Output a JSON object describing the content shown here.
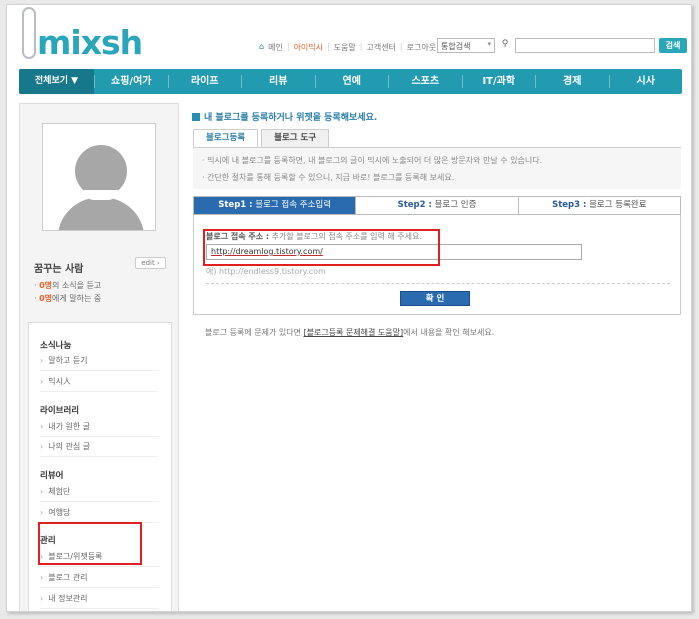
{
  "brand": {
    "logo": "mixsh",
    "accent": "#2aa6ba",
    "nav_bg": "#229aaf",
    "step_active": "#2a6bb0",
    "highlight": "#e02020"
  },
  "top_links": {
    "home_icon": "home-icon",
    "items": [
      "메인",
      "아이믹시",
      "도움말",
      "고객센터",
      "로그아웃"
    ]
  },
  "search": {
    "scope": "통합검색",
    "search_icon": "magnifier-icon",
    "button": "검색"
  },
  "gnb": {
    "items": [
      "전체보기 ▼",
      "쇼핑/여가",
      "라이프",
      "리뷰",
      "연예",
      "스포츠",
      "IT/과학",
      "경제",
      "시사"
    ]
  },
  "profile": {
    "name": "꿈꾸는 사람",
    "edit_label": "edit ›",
    "stat1_count": "0명",
    "stat1_text": "의 소식을 듣고",
    "stat2_count": "0명",
    "stat2_text": "에게 말하는 중"
  },
  "side_menu": {
    "sections": [
      "소식나눔",
      "라이브러리",
      "리뷰어",
      "관리"
    ],
    "items": [
      "말하고 듣기",
      "믹시人",
      "내가 원한 글",
      "나의 관심 글",
      "체험단",
      "여행당",
      "블로그/위젯등록",
      "블로그 관리",
      "내 정보관리"
    ]
  },
  "main": {
    "notice": "내 블로그를 등록하거나 위젯을 등록해보세요.",
    "tabs": [
      "블로그등록",
      "블로그 도구"
    ],
    "info": [
      "믹시에 내 블로그를 등록하면, 내 블로그의 글이 믹시에 노출되어 더 많은 방문자와 만날 수 있습니다.",
      "간단한 절차를 통해 등록할 수 있으니, 지금 바로! 블로그를 등록해 보세요."
    ],
    "steps": [
      {
        "num": "Step1 :",
        "label": "블로그 접속 주소입력"
      },
      {
        "num": "Step2 :",
        "label": "블로그 인증"
      },
      {
        "num": "Step3 :",
        "label": "블로그 등록완료"
      }
    ],
    "address_label": "블로그 접속 주소 :",
    "address_hint": "추가할 블로그의 접속 주소를 입력 해 주세요.",
    "address_value": "http://dreamlog.tistory.com/",
    "example": "예) http://endless9.tistory.com",
    "confirm": "확 인",
    "help_pre": "블로그 등록에 문제가 있다면",
    "help_link": "[블로그등록 문제해결 도움말]",
    "help_post": "에서 내용을 확인 해보세요."
  }
}
